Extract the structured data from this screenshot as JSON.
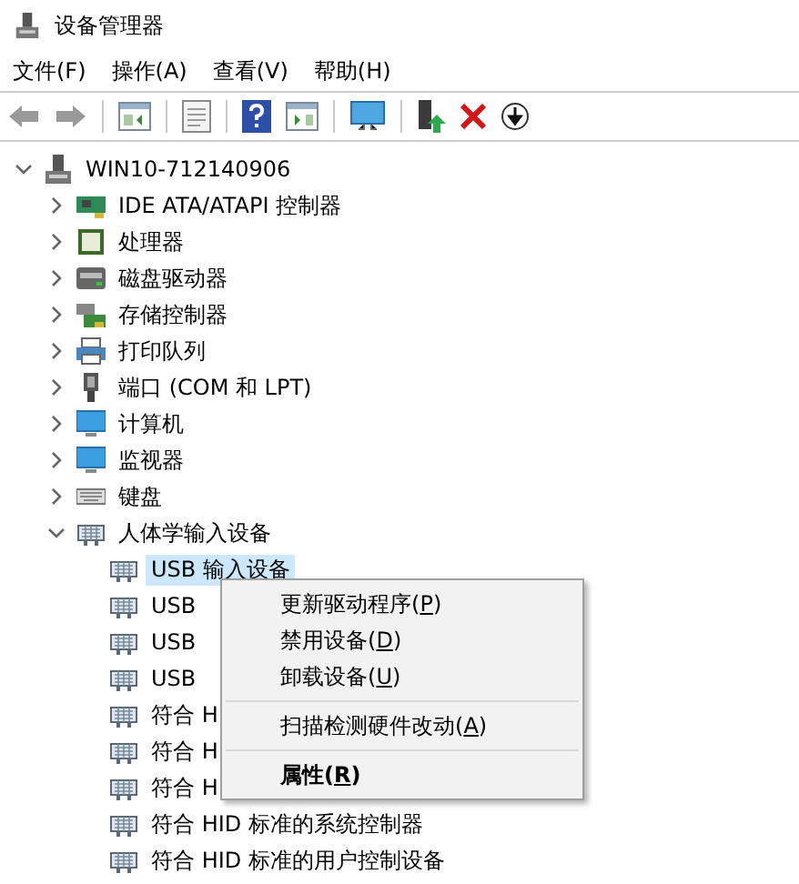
{
  "window": {
    "title": "设备管理器"
  },
  "menu_bar": [
    "文件(F)",
    "操作(A)",
    "查看(V)",
    "帮助(H)"
  ],
  "toolbar": [
    {
      "kind": "back"
    },
    {
      "kind": "forward"
    },
    {
      "kind": "sep"
    },
    {
      "kind": "tree"
    },
    {
      "kind": "sep"
    },
    {
      "kind": "props"
    },
    {
      "kind": "sep"
    },
    {
      "kind": "help"
    },
    {
      "kind": "pane"
    },
    {
      "kind": "sep"
    },
    {
      "kind": "scan"
    },
    {
      "kind": "sep"
    },
    {
      "kind": "update"
    },
    {
      "kind": "remove"
    },
    {
      "kind": "download"
    }
  ],
  "tree": [
    {
      "label": "WIN10-712140906",
      "kind": "host",
      "expanded": true,
      "selected": false,
      "children": [
        {
          "label": "IDE ATA/ATAPI 控制器",
          "kind": "board",
          "expanded": false,
          "selected": false
        },
        {
          "label": "处理器",
          "kind": "chip",
          "expanded": false,
          "selected": false
        },
        {
          "label": "磁盘驱动器",
          "kind": "disk",
          "expanded": false,
          "selected": false
        },
        {
          "label": "存储控制器",
          "kind": "storage",
          "expanded": false,
          "selected": false
        },
        {
          "label": "打印队列",
          "kind": "printer",
          "expanded": false,
          "selected": false
        },
        {
          "label": "端口 (COM 和 LPT)",
          "kind": "port",
          "expanded": false,
          "selected": false
        },
        {
          "label": "计算机",
          "kind": "monitor",
          "expanded": false,
          "selected": false
        },
        {
          "label": "监视器",
          "kind": "monitor",
          "expanded": false,
          "selected": false
        },
        {
          "label": "键盘",
          "kind": "keyboard",
          "expanded": false,
          "selected": false
        },
        {
          "label": "人体学输入设备",
          "kind": "hid",
          "expanded": true,
          "selected": false,
          "children": [
            {
              "label": "USB 输入设备",
              "kind": "hid",
              "selected": true
            },
            {
              "label": "USB",
              "kind": "hid",
              "selected": false
            },
            {
              "label": "USB",
              "kind": "hid",
              "selected": false
            },
            {
              "label": "USB",
              "kind": "hid",
              "selected": false
            },
            {
              "label": "符合 H",
              "kind": "hid",
              "selected": false
            },
            {
              "label": "符合 H",
              "kind": "hid",
              "selected": false
            },
            {
              "label": "符合 H",
              "kind": "hid",
              "selected": false
            },
            {
              "label": "符合 HID 标准的系统控制器",
              "kind": "hid",
              "selected": false
            },
            {
              "label": "符合 HID 标准的用户控制设备",
              "kind": "hid",
              "selected": false
            }
          ]
        }
      ]
    }
  ],
  "context_menu": [
    {
      "kind": "item",
      "text": "更新驱动程序(",
      "access_key": "P",
      "after": ")",
      "bold": false
    },
    {
      "kind": "item",
      "text": "禁用设备(",
      "access_key": "D",
      "after": ")",
      "bold": false
    },
    {
      "kind": "item",
      "text": "卸载设备(",
      "access_key": "U",
      "after": ")",
      "bold": false
    },
    {
      "kind": "sep"
    },
    {
      "kind": "item",
      "text": "扫描检测硬件改动(",
      "access_key": "A",
      "after": ")",
      "bold": false
    },
    {
      "kind": "sep"
    },
    {
      "kind": "item",
      "text": "属性(",
      "access_key": "R",
      "after": ")",
      "bold": true
    }
  ]
}
